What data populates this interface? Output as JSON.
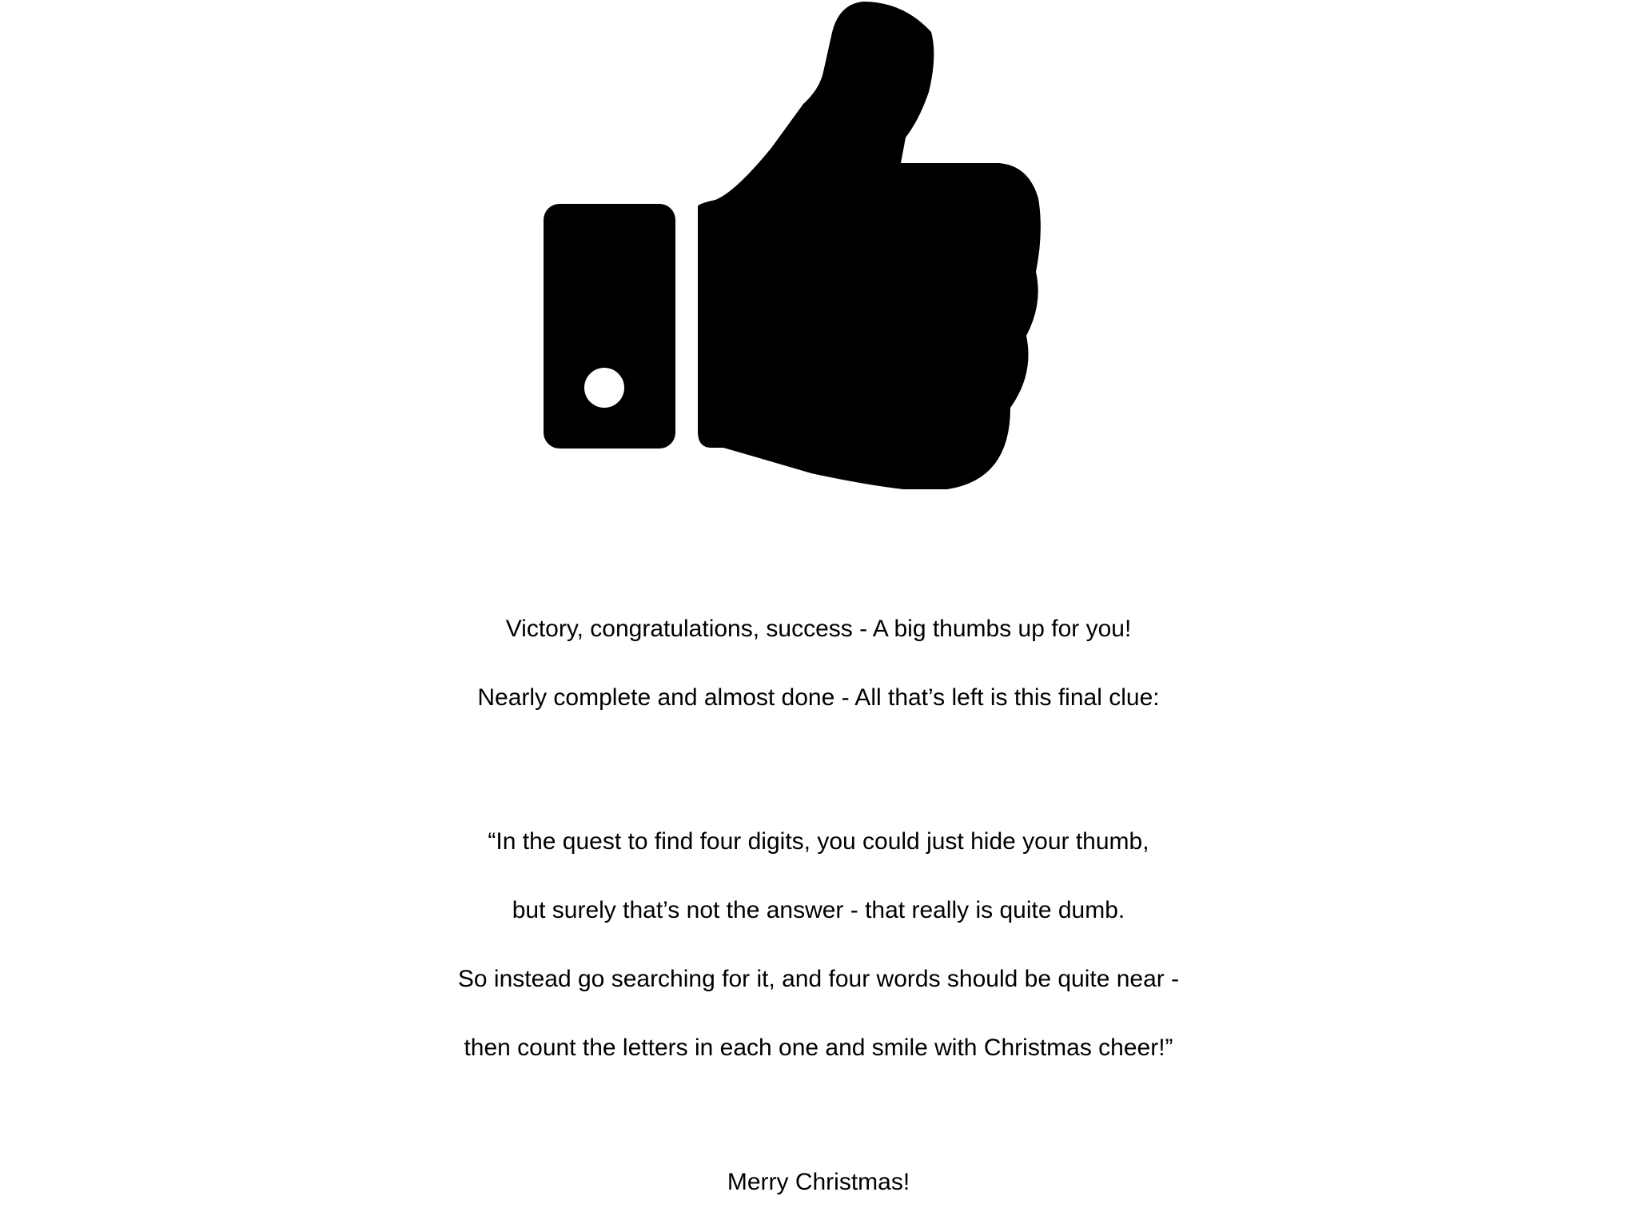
{
  "icon": {
    "name": "thumbs-up-icon",
    "color": "#000000"
  },
  "intro_lines": [
    "Victory, congratulations, success - A big thumbs up for you!",
    "Nearly complete and almost done - All that’s left is this final clue:"
  ],
  "clue_lines": [
    "“In the quest to find four digits, you could just hide your thumb,",
    "but surely that’s not the answer - that really is quite dumb.",
    "So instead go searching for it, and four words should be quite near -",
    "then count the letters in each one and smile with Christmas cheer!”"
  ],
  "signoff": "Merry Christmas!"
}
